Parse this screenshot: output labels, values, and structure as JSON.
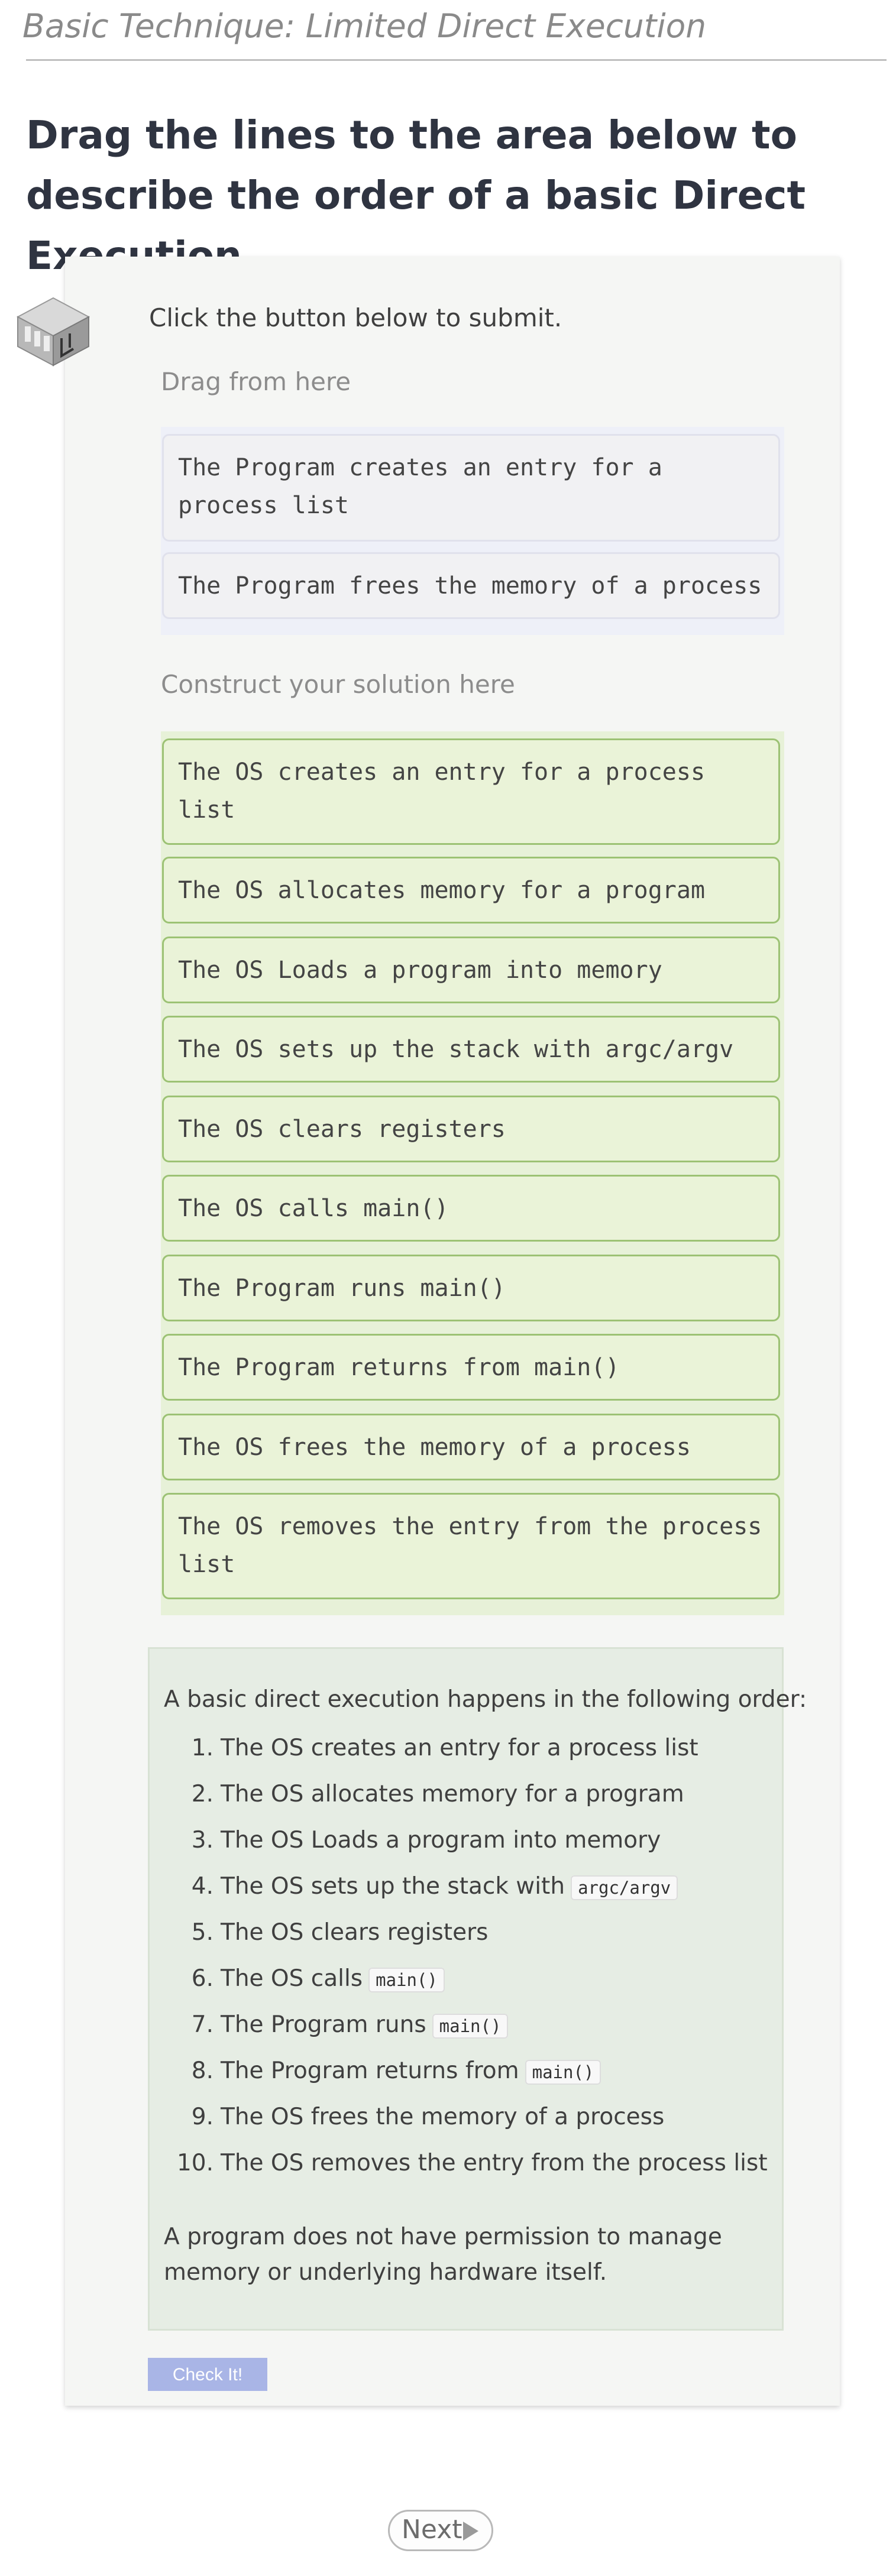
{
  "page": {
    "title": "Basic Technique: Limited Direct Execution",
    "heading": "Drag the lines to the area below to describe the order of a basic Direct Execution."
  },
  "exercise": {
    "icon": "server-cube-icon",
    "instruction": "Click the button below to submit.",
    "source_label": "Drag from here",
    "source_items": [
      "The Program creates an entry for a process list",
      "The Program frees the memory of a process"
    ],
    "target_label": "Construct your solution here",
    "target_items": [
      "The OS creates an entry for a process list",
      "The OS allocates memory for a program",
      "The OS Loads a program into memory",
      "The OS sets up the stack with argc/argv",
      "The OS clears registers",
      "The OS calls main()",
      "The Program runs main()",
      "The Program returns from main()",
      "The OS frees the memory of a process",
      "The OS removes the entry from the process list"
    ]
  },
  "feedback": {
    "intro": "A basic direct execution happens in the following order:",
    "steps": [
      {
        "num": "1.",
        "text": "The OS creates an entry for a process list",
        "code": ""
      },
      {
        "num": "2.",
        "text": "The OS allocates memory for a program",
        "code": ""
      },
      {
        "num": "3.",
        "text": "The OS Loads a program into memory",
        "code": ""
      },
      {
        "num": "4.",
        "text": "The OS sets up the stack with",
        "code": "argc/argv"
      },
      {
        "num": "5.",
        "text": "The OS clears registers",
        "code": ""
      },
      {
        "num": "6.",
        "text": "The OS calls",
        "code": "main()"
      },
      {
        "num": "7.",
        "text": "The Program runs",
        "code": "main()"
      },
      {
        "num": "8.",
        "text": "The Program returns from",
        "code": "main()"
      },
      {
        "num": "9.",
        "text": "The OS frees the memory of a process",
        "code": ""
      },
      {
        "num": "10.",
        "text": "The OS removes the entry from the process list",
        "code": ""
      }
    ],
    "note": "A program does not have permission to manage memory or underlying hardware itself."
  },
  "buttons": {
    "check": "Check It!",
    "next": "Next"
  },
  "colors": {
    "check_button": "#a9b5e6",
    "target_block_border": "#9cc274",
    "target_zone": "#e7f1d8",
    "source_zone": "#eef0f8"
  }
}
